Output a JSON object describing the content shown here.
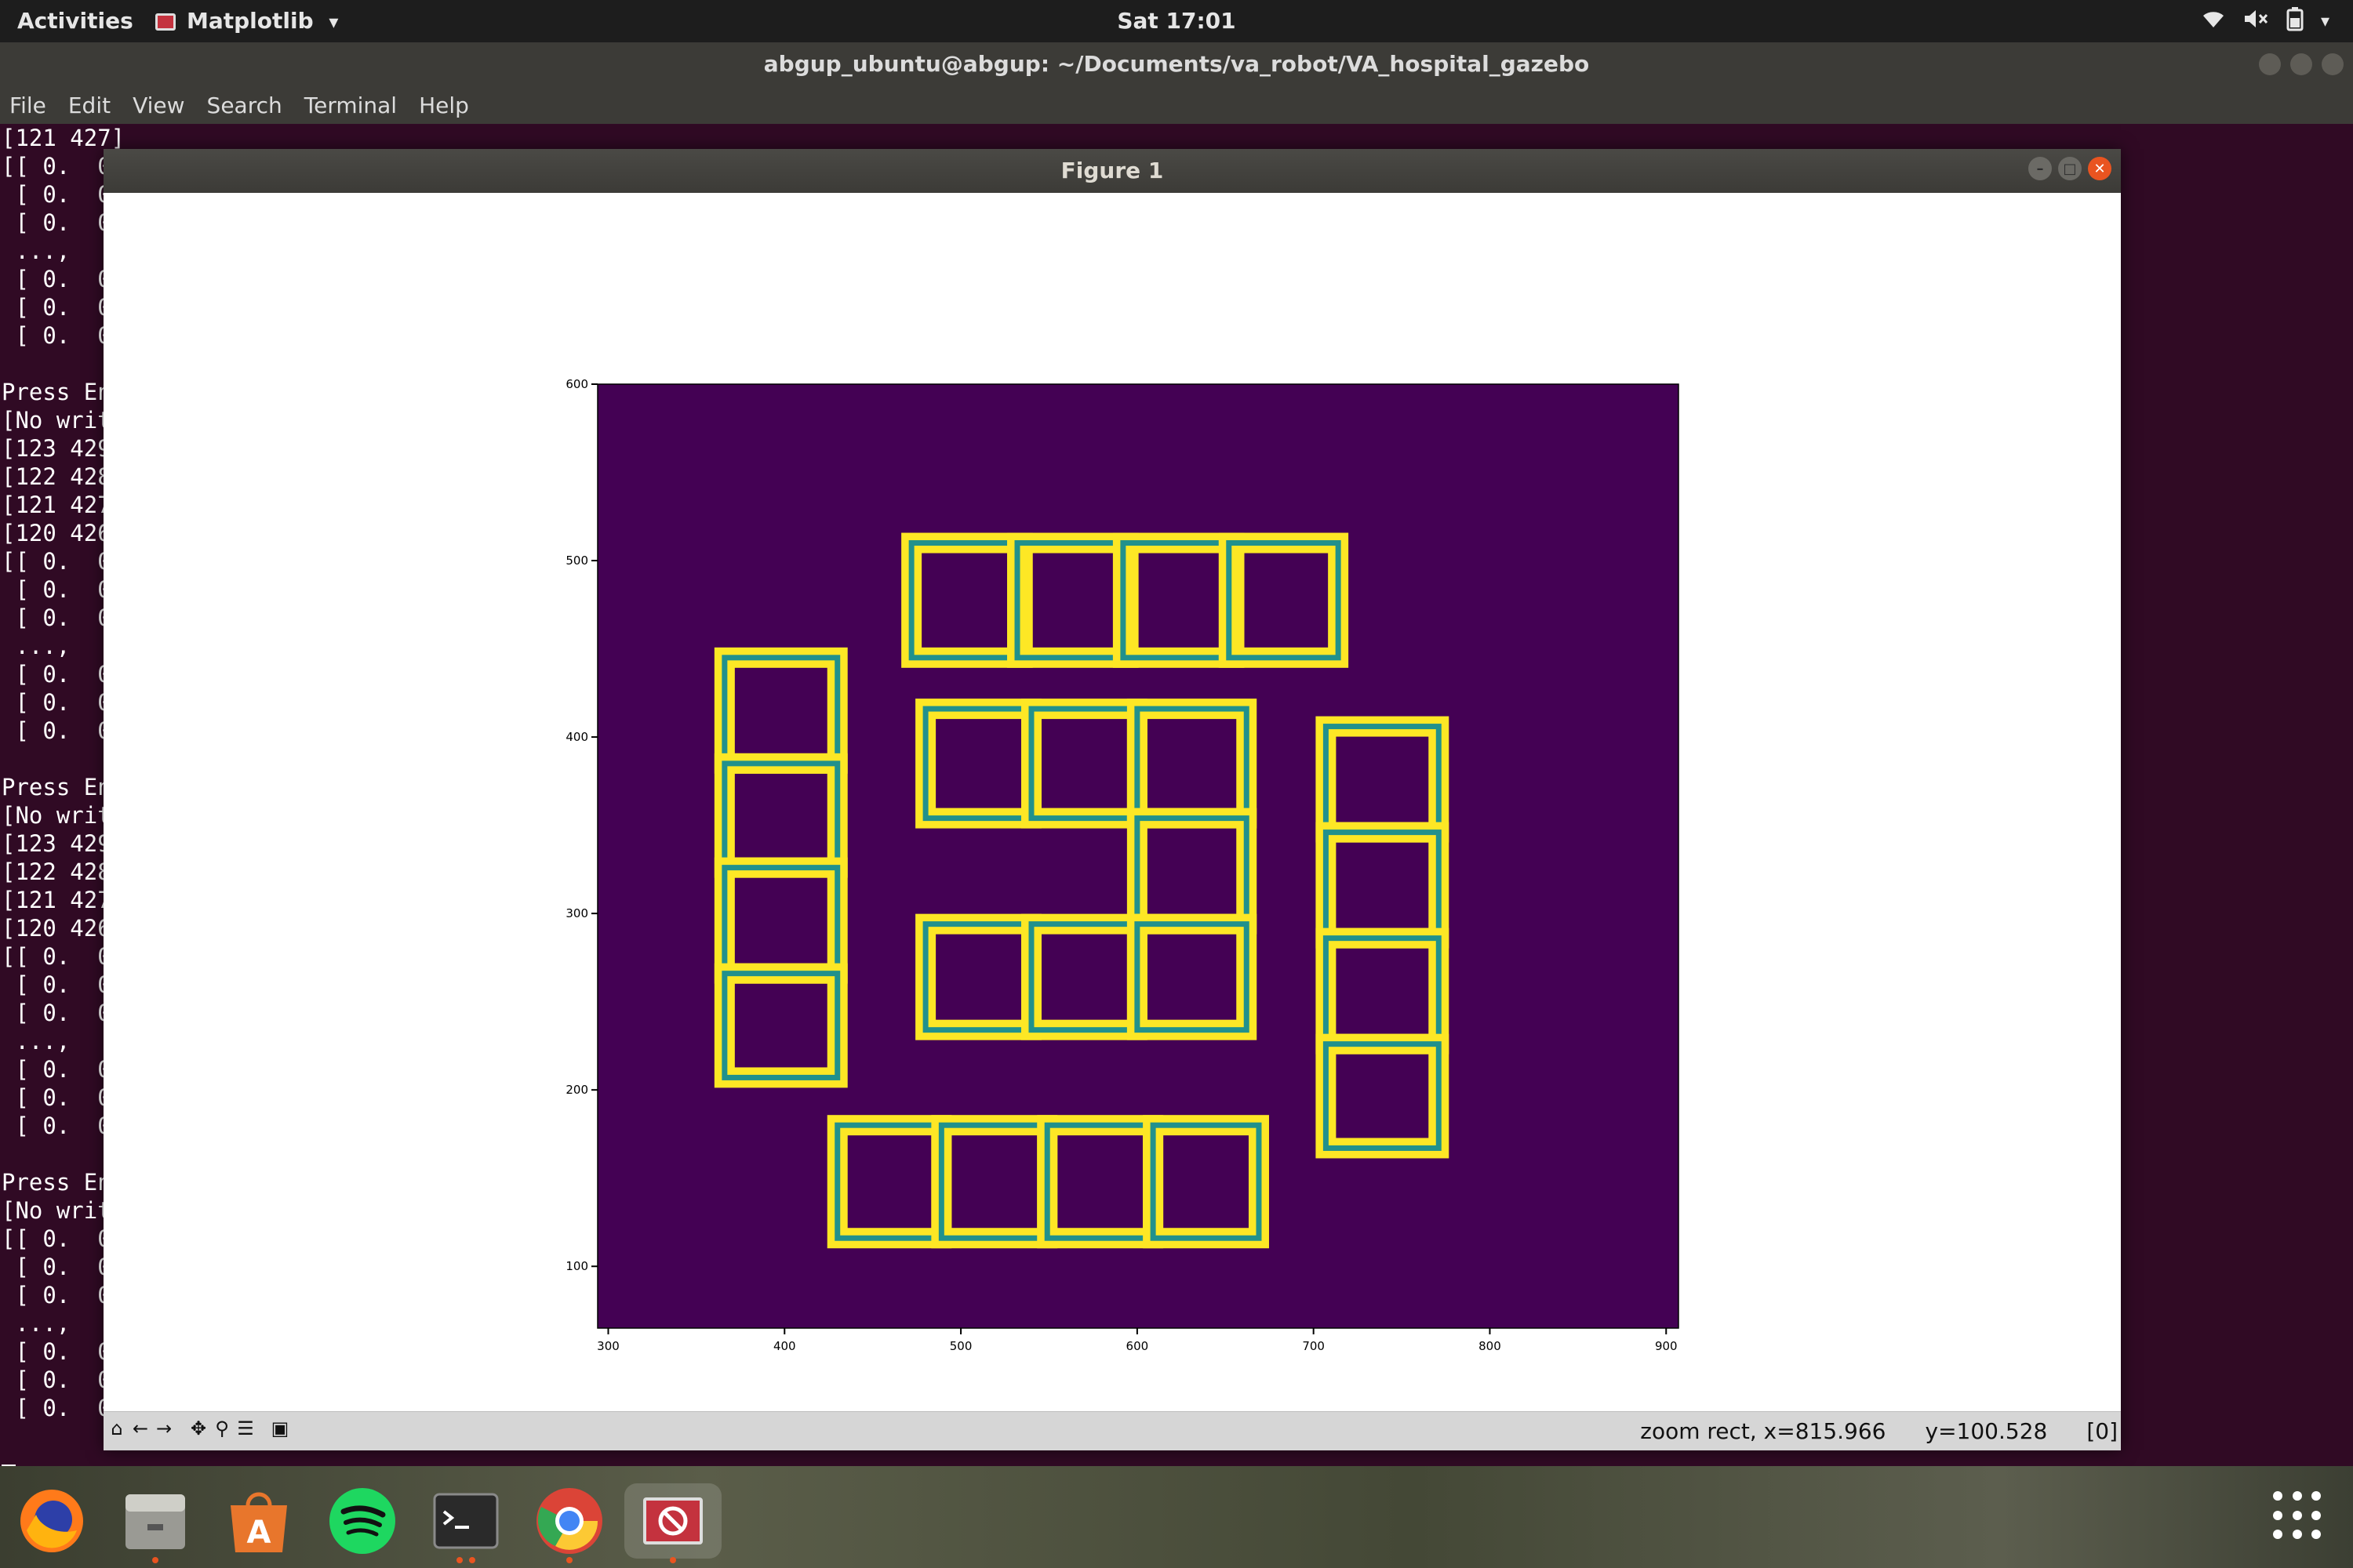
{
  "topbar": {
    "activities": "Activities",
    "app_name": "Matplotlib",
    "app_menu_arrow": "▾",
    "clock": "Sat 17:01",
    "tray_icons": [
      "wifi-icon",
      "volume-muted-icon",
      "battery-icon",
      "power-menu-arrow"
    ]
  },
  "terminal": {
    "title": "abgup_ubuntu@abgup: ~/Documents/va_robot/VA_hospital_gazebo",
    "menu": [
      "File",
      "Edit",
      "View",
      "Search",
      "Terminal",
      "Help"
    ],
    "lines": [
      "[121 427]",
      "[[ 0.  0",
      " [ 0.  0",
      " [ 0.  0",
      " ...,",
      " [ 0.  0",
      " [ 0.  0",
      " [ 0.  0",
      "",
      "Press En",
      "[No writ",
      "[123 429",
      "[122 428",
      "[121 427",
      "[120 426",
      "[[ 0.  0",
      " [ 0.  0",
      " [ 0.  0",
      " ...,",
      " [ 0.  0",
      " [ 0.  0",
      " [ 0.  0",
      "",
      "Press En",
      "[No writ",
      "[123 429",
      "[122 428",
      "[121 427",
      "[120 426",
      "[[ 0.  0",
      " [ 0.  0",
      " [ 0.  0",
      " ...,",
      " [ 0.  0",
      " [ 0.  0",
      " [ 0.  0",
      "",
      "Press En",
      "[No writ",
      "[[ 0.  0",
      " [ 0.  0",
      " [ 0.  0",
      " ...,",
      " [ 0.  0",
      " [ 0.  0",
      " [ 0.  0"
    ]
  },
  "figure": {
    "title": "Figure 1",
    "status_zoom": "zoom rect, x=815.966",
    "status_y": "y=100.528",
    "status_value": "[0]",
    "toolbar_tools": [
      "home-icon",
      "back-icon",
      "forward-icon",
      "pan-icon",
      "zoom-icon",
      "subplots-icon",
      "save-icon"
    ]
  },
  "chart_data": {
    "type": "heatmap",
    "title": "",
    "xlabel": "",
    "ylabel": "",
    "xlim": [
      294,
      907
    ],
    "ylim": [
      65,
      600
    ],
    "xticks": [
      300,
      400,
      500,
      600,
      700,
      800,
      900
    ],
    "yticks": [
      100,
      200,
      300,
      400,
      500,
      600
    ],
    "colors": {
      "background": "#440154",
      "wall": "#fde725",
      "centerline": "#21918c"
    },
    "outer_rooms": [
      {
        "x": [
          472,
          535
        ],
        "y": [
          445,
          510
        ]
      },
      {
        "x": [
          532,
          595
        ],
        "y": [
          445,
          510
        ]
      },
      {
        "x": [
          592,
          655
        ],
        "y": [
          445,
          510
        ]
      },
      {
        "x": [
          652,
          714
        ],
        "y": [
          445,
          510
        ]
      },
      {
        "x": [
          366,
          430
        ],
        "y": [
          385,
          445
        ]
      },
      {
        "x": [
          366,
          430
        ],
        "y": [
          326,
          385
        ]
      },
      {
        "x": [
          366,
          430
        ],
        "y": [
          266,
          326
        ]
      },
      {
        "x": [
          366,
          430
        ],
        "y": [
          207,
          266
        ]
      },
      {
        "x": [
          707,
          771
        ],
        "y": [
          346,
          406
        ]
      },
      {
        "x": [
          707,
          771
        ],
        "y": [
          286,
          346
        ]
      },
      {
        "x": [
          707,
          771
        ],
        "y": [
          226,
          286
        ]
      },
      {
        "x": [
          707,
          771
        ],
        "y": [
          167,
          226
        ]
      },
      {
        "x": [
          430,
          489
        ],
        "y": [
          116,
          180
        ]
      },
      {
        "x": [
          489,
          549
        ],
        "y": [
          116,
          180
        ]
      },
      {
        "x": [
          549,
          609
        ],
        "y": [
          116,
          180
        ]
      },
      {
        "x": [
          609,
          669
        ],
        "y": [
          116,
          180
        ]
      }
    ],
    "inner_rooms": [
      {
        "x": [
          480,
          540
        ],
        "y": [
          354,
          416
        ]
      },
      {
        "x": [
          540,
          600
        ],
        "y": [
          354,
          416
        ]
      },
      {
        "x": [
          600,
          662
        ],
        "y": [
          354,
          416
        ]
      },
      {
        "x": [
          600,
          662
        ],
        "y": [
          294,
          354
        ]
      },
      {
        "x": [
          480,
          540
        ],
        "y": [
          234,
          294
        ]
      },
      {
        "x": [
          540,
          600
        ],
        "y": [
          234,
          294
        ]
      },
      {
        "x": [
          600,
          662
        ],
        "y": [
          234,
          294
        ]
      }
    ],
    "corridor": {
      "x": [
        430,
        707
      ],
      "y": [
        180,
        445
      ]
    }
  }
}
